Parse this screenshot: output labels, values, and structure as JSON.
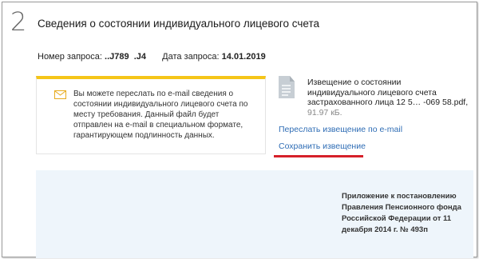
{
  "step": {
    "number": "2"
  },
  "header": {
    "title": "Сведения о состоянии индивидуального лицевого счета"
  },
  "meta": {
    "request_number_label": "Номер запроса:",
    "request_number_value": "..J789  .J4",
    "request_date_label": "Дата запроса:",
    "request_date_value": "14.01.2019"
  },
  "notice": {
    "icon": "envelope-icon",
    "text": "Вы можете переслать по e-mail сведения о состоянии индивидуального лицевого счета по месту требования. Данный файл будет отправлен на e-mail в специальном формате, гарантирующем подлинность данных.",
    "accent_color": "#f5c518"
  },
  "document": {
    "icon": "file-icon",
    "title": "Извещение о состоянии индивидуального лицевого счета застрахованного лица 12 5… -069 58.pdf,",
    "size": "91.97 кБ."
  },
  "actions": {
    "email_link": "Переслать извещение по e-mail",
    "save_link": "Сохранить извещение",
    "link_color": "#2f6db5",
    "highlight_color": "#d6202a"
  },
  "appendix": {
    "text": "Приложение к постановлению Правления Пенсионного фонда Российской Федерации от 11 декабря 2014 г. № 493п"
  }
}
